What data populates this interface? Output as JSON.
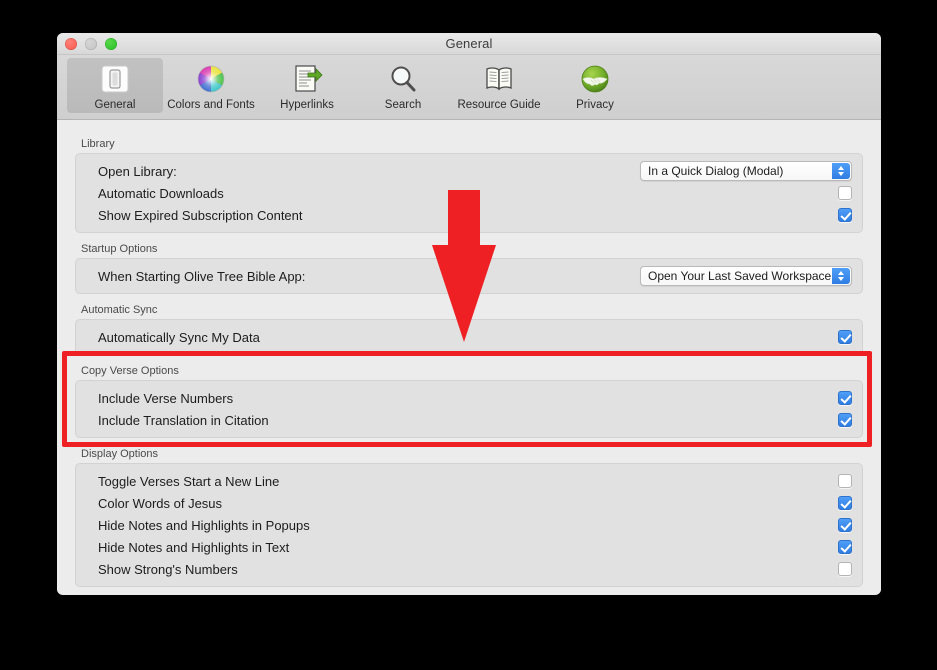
{
  "window": {
    "title": "General",
    "traffic_lights": [
      "close",
      "minimize",
      "zoom"
    ]
  },
  "toolbar": {
    "items": [
      {
        "label": "General",
        "icon": "general-icon",
        "selected": true
      },
      {
        "label": "Colors and Fonts",
        "icon": "color-wheel-icon",
        "selected": false
      },
      {
        "label": "Hyperlinks",
        "icon": "hyperlink-icon",
        "selected": false
      },
      {
        "label": "Search",
        "icon": "magnifier-icon",
        "selected": false
      },
      {
        "label": "Resource Guide",
        "icon": "open-book-icon",
        "selected": false
      },
      {
        "label": "Privacy",
        "icon": "handshake-icon",
        "selected": false
      }
    ]
  },
  "groups": [
    {
      "title": "Library",
      "rows": [
        {
          "label": "Open Library:",
          "control": "popup",
          "value": "In a Quick Dialog (Modal)"
        },
        {
          "label": "Automatic Downloads",
          "control": "checkbox",
          "checked": false
        },
        {
          "label": "Show Expired Subscription Content",
          "control": "checkbox",
          "checked": true
        }
      ]
    },
    {
      "title": "Startup Options",
      "rows": [
        {
          "label": "When Starting Olive Tree Bible App:",
          "control": "popup",
          "value": "Open Your Last Saved Workspace"
        }
      ]
    },
    {
      "title": "Automatic Sync",
      "rows": [
        {
          "label": "Automatically Sync My Data",
          "control": "checkbox",
          "checked": true
        }
      ]
    },
    {
      "title": "Copy Verse Options",
      "highlighted": true,
      "rows": [
        {
          "label": "Include Verse Numbers",
          "control": "checkbox",
          "checked": true
        },
        {
          "label": "Include Translation in Citation",
          "control": "checkbox",
          "checked": true
        }
      ]
    },
    {
      "title": "Display Options",
      "rows": [
        {
          "label": "Toggle Verses Start a New Line",
          "control": "checkbox",
          "checked": false
        },
        {
          "label": "Color Words of Jesus",
          "control": "checkbox",
          "checked": true
        },
        {
          "label": "Hide Notes and Highlights in Popups",
          "control": "checkbox",
          "checked": true
        },
        {
          "label": "Hide Notes and Highlights in Text",
          "control": "checkbox",
          "checked": true
        },
        {
          "label": "Show Strong's Numbers",
          "control": "checkbox",
          "checked": false
        }
      ]
    }
  ],
  "annotations": {
    "arrow": {
      "name": "red-down-arrow-annotation",
      "color": "#ee2024"
    },
    "highlight_box": {
      "name": "red-highlight-box-annotation",
      "color": "#ee2024",
      "targets": "Copy Verse Options"
    }
  }
}
